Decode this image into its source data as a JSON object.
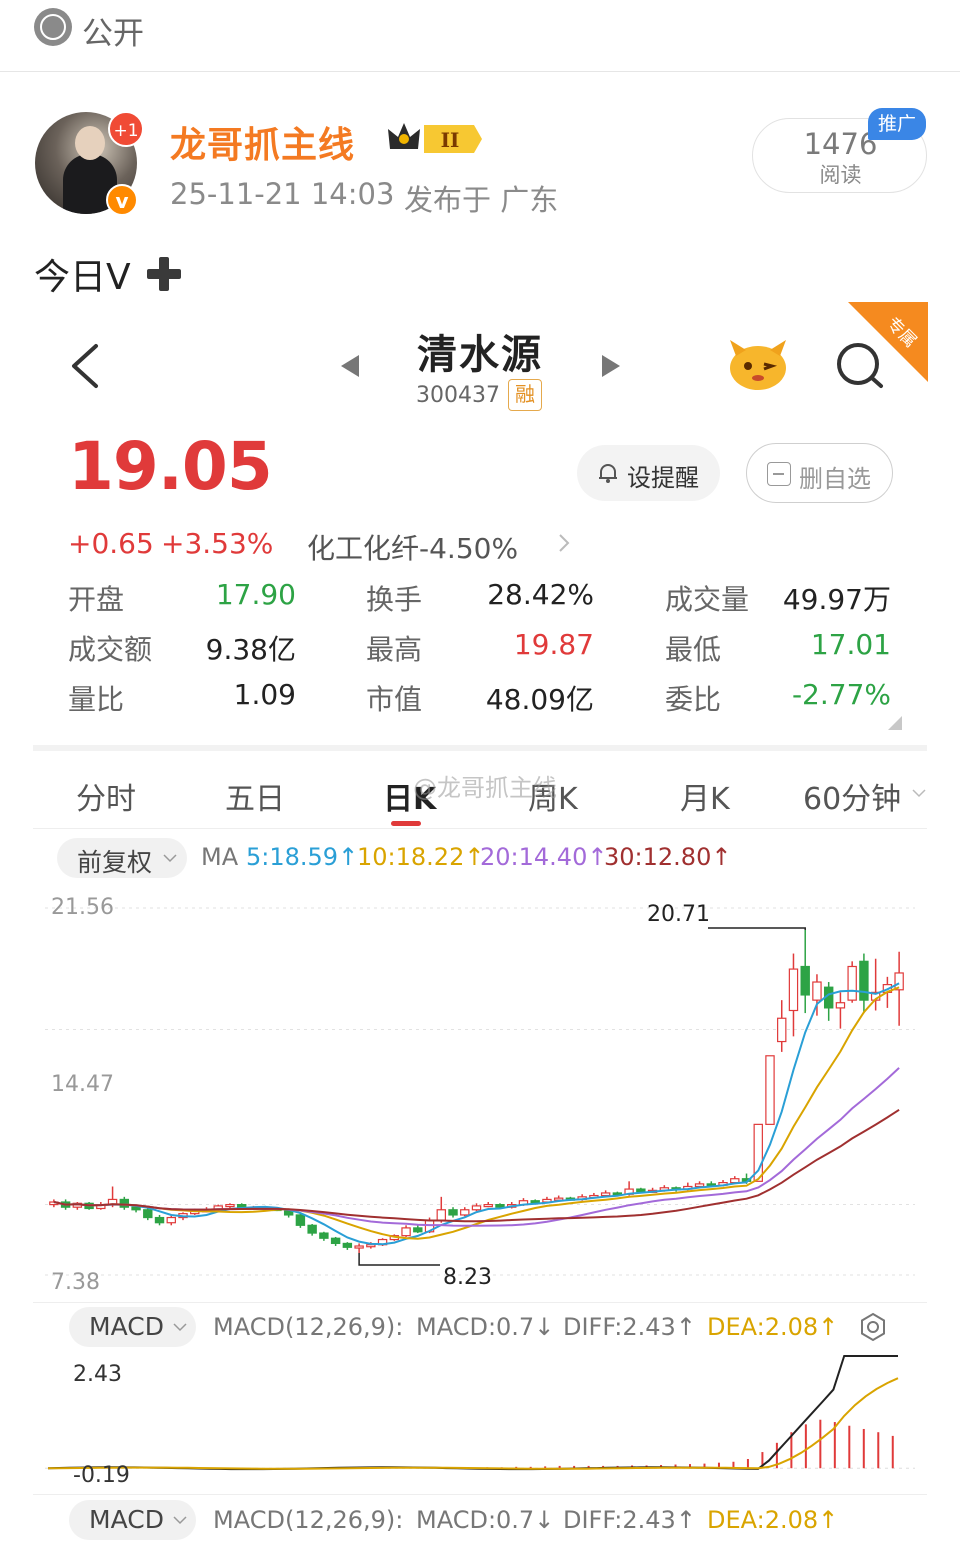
{
  "post": {
    "visibility": "公开",
    "author": {
      "name": "龙哥抓主线",
      "level": "II",
      "badge_plus": "+1"
    },
    "meta": {
      "time": "25-11-21 14:03",
      "location": "发布于 广东"
    },
    "reads": {
      "count": "1476",
      "label": "阅读",
      "promo": "推广"
    },
    "text": "今日V"
  },
  "stock": {
    "name": "清水源",
    "code": "300437",
    "margin_tag": "融",
    "exclusive_tag": "专属",
    "price": "19.05",
    "change": "+0.65",
    "change_pct": "+3.53%",
    "sector": "化工化纤-4.50%",
    "alert_label": "设提醒",
    "remove_label": "删自选",
    "quotes": [
      {
        "label": "开盘",
        "value": "17.90",
        "color": "#2da345"
      },
      {
        "label": "换手",
        "value": "28.42%",
        "color": "#222222"
      },
      {
        "label": "成交量",
        "value": "49.97万",
        "color": "#222222"
      },
      {
        "label": "成交额",
        "value": "9.38亿",
        "color": "#222222"
      },
      {
        "label": "最高",
        "value": "19.87",
        "color": "#e03a3a"
      },
      {
        "label": "最低",
        "value": "17.01",
        "color": "#2da345"
      },
      {
        "label": "量比",
        "value": "1.09",
        "color": "#222222"
      },
      {
        "label": "市值",
        "value": "48.09亿",
        "color": "#222222"
      },
      {
        "label": "委比",
        "value": "-2.77%",
        "color": "#2da345"
      }
    ]
  },
  "tabs": [
    "分时",
    "五日",
    "日K",
    "周K",
    "月K",
    "60分钟"
  ],
  "active_tab": "日K",
  "watermark": "@龙哥抓主线",
  "kline": {
    "adjust": "前复权",
    "ma_prefix": "MA",
    "ma5": "5:18.59↑",
    "ma10": "10:18.22↑",
    "ma20": "20:14.40↑",
    "ma30": "30:12.80↑",
    "axis_top": "21.56",
    "axis_mid": "14.47",
    "axis_bottom": "7.38",
    "high_mark": "20.71",
    "low_mark": "8.23"
  },
  "macd": {
    "selector": "MACD",
    "params": "MACD(12,26,9):",
    "macd": "MACD:0.7↓",
    "diff": "DIFF:2.43↑",
    "dea": "DEA:2.08↑",
    "axis_top": "2.43",
    "axis_bottom": "-0.19"
  },
  "colors": {
    "up": "#e03a3a",
    "down": "#2da345",
    "accent": "#f47a22",
    "ma5": "#2a9fd6",
    "ma10": "#d9a400",
    "ma20": "#a36ad9",
    "ma30": "#a03030"
  },
  "chart_data": {
    "type": "candlestick",
    "y_range": [
      7.38,
      21.56
    ],
    "annotations": [
      {
        "label": "20.71",
        "kind": "high"
      },
      {
        "label": "8.23",
        "kind": "low"
      }
    ],
    "candles": [
      {
        "o": 10.1,
        "c": 10.2,
        "h": 10.3,
        "l": 10.0
      },
      {
        "o": 10.2,
        "c": 10.0,
        "h": 10.3,
        "l": 9.9
      },
      {
        "o": 10.0,
        "c": 10.15,
        "h": 10.2,
        "l": 9.9
      },
      {
        "o": 10.15,
        "c": 9.95,
        "h": 10.2,
        "l": 9.9
      },
      {
        "o": 9.95,
        "c": 10.1,
        "h": 10.2,
        "l": 9.9
      },
      {
        "o": 10.1,
        "c": 10.3,
        "h": 10.8,
        "l": 10.0
      },
      {
        "o": 10.3,
        "c": 10.0,
        "h": 10.4,
        "l": 9.9
      },
      {
        "o": 10.0,
        "c": 9.9,
        "h": 10.1,
        "l": 9.8
      },
      {
        "o": 9.9,
        "c": 9.6,
        "h": 9.95,
        "l": 9.5
      },
      {
        "o": 9.6,
        "c": 9.4,
        "h": 9.7,
        "l": 9.3
      },
      {
        "o": 9.4,
        "c": 9.6,
        "h": 9.7,
        "l": 9.3
      },
      {
        "o": 9.6,
        "c": 9.75,
        "h": 9.8,
        "l": 9.5
      },
      {
        "o": 9.75,
        "c": 9.85,
        "h": 9.95,
        "l": 9.7
      },
      {
        "o": 9.85,
        "c": 9.9,
        "h": 10.0,
        "l": 9.8
      },
      {
        "o": 9.9,
        "c": 10.05,
        "h": 10.1,
        "l": 9.85
      },
      {
        "o": 10.05,
        "c": 10.1,
        "h": 10.15,
        "l": 9.95
      },
      {
        "o": 10.1,
        "c": 9.95,
        "h": 10.15,
        "l": 9.9
      },
      {
        "o": 9.95,
        "c": 10.0,
        "h": 10.05,
        "l": 9.9
      },
      {
        "o": 10.0,
        "c": 9.95,
        "h": 10.05,
        "l": 9.9
      },
      {
        "o": 9.95,
        "c": 9.9,
        "h": 10.0,
        "l": 9.85
      },
      {
        "o": 9.9,
        "c": 9.7,
        "h": 9.95,
        "l": 9.6
      },
      {
        "o": 9.7,
        "c": 9.3,
        "h": 9.75,
        "l": 9.2
      },
      {
        "o": 9.3,
        "c": 9.0,
        "h": 9.35,
        "l": 8.9
      },
      {
        "o": 9.0,
        "c": 8.8,
        "h": 9.05,
        "l": 8.7
      },
      {
        "o": 8.8,
        "c": 8.6,
        "h": 8.85,
        "l": 8.5
      },
      {
        "o": 8.6,
        "c": 8.45,
        "h": 8.65,
        "l": 8.35
      },
      {
        "o": 8.45,
        "c": 8.5,
        "h": 8.6,
        "l": 8.23
      },
      {
        "o": 8.5,
        "c": 8.55,
        "h": 8.65,
        "l": 8.4
      },
      {
        "o": 8.55,
        "c": 8.75,
        "h": 8.8,
        "l": 8.5
      },
      {
        "o": 8.75,
        "c": 8.9,
        "h": 8.95,
        "l": 8.7
      },
      {
        "o": 8.9,
        "c": 9.2,
        "h": 9.3,
        "l": 8.85
      },
      {
        "o": 9.2,
        "c": 9.05,
        "h": 9.3,
        "l": 9.0
      },
      {
        "o": 9.05,
        "c": 9.5,
        "h": 9.6,
        "l": 9.0
      },
      {
        "o": 9.5,
        "c": 9.9,
        "h": 10.4,
        "l": 9.4
      },
      {
        "o": 9.9,
        "c": 9.7,
        "h": 10.0,
        "l": 9.6
      },
      {
        "o": 9.7,
        "c": 9.9,
        "h": 10.0,
        "l": 9.65
      },
      {
        "o": 9.9,
        "c": 10.05,
        "h": 10.15,
        "l": 9.85
      },
      {
        "o": 10.05,
        "c": 10.1,
        "h": 10.2,
        "l": 10.0
      },
      {
        "o": 10.1,
        "c": 10.0,
        "h": 10.15,
        "l": 9.95
      },
      {
        "o": 10.0,
        "c": 10.1,
        "h": 10.2,
        "l": 9.95
      },
      {
        "o": 10.1,
        "c": 10.25,
        "h": 10.35,
        "l": 10.05
      },
      {
        "o": 10.25,
        "c": 10.2,
        "h": 10.3,
        "l": 10.1
      },
      {
        "o": 10.2,
        "c": 10.3,
        "h": 10.4,
        "l": 10.15
      },
      {
        "o": 10.3,
        "c": 10.35,
        "h": 10.45,
        "l": 10.25
      },
      {
        "o": 10.35,
        "c": 10.3,
        "h": 10.4,
        "l": 10.25
      },
      {
        "o": 10.3,
        "c": 10.4,
        "h": 10.5,
        "l": 10.25
      },
      {
        "o": 10.4,
        "c": 10.45,
        "h": 10.55,
        "l": 10.35
      },
      {
        "o": 10.45,
        "c": 10.55,
        "h": 10.65,
        "l": 10.4
      },
      {
        "o": 10.55,
        "c": 10.5,
        "h": 10.6,
        "l": 10.45
      },
      {
        "o": 10.5,
        "c": 10.7,
        "h": 11.0,
        "l": 10.45
      },
      {
        "o": 10.7,
        "c": 10.6,
        "h": 10.75,
        "l": 10.55
      },
      {
        "o": 10.6,
        "c": 10.65,
        "h": 10.75,
        "l": 10.55
      },
      {
        "o": 10.65,
        "c": 10.75,
        "h": 10.85,
        "l": 10.6
      },
      {
        "o": 10.75,
        "c": 10.7,
        "h": 10.8,
        "l": 10.6
      },
      {
        "o": 10.7,
        "c": 10.8,
        "h": 10.95,
        "l": 10.65
      },
      {
        "o": 10.8,
        "c": 10.9,
        "h": 11.0,
        "l": 10.75
      },
      {
        "o": 10.9,
        "c": 10.85,
        "h": 11.0,
        "l": 10.8
      },
      {
        "o": 10.85,
        "c": 10.95,
        "h": 11.05,
        "l": 10.8
      },
      {
        "o": 10.95,
        "c": 11.1,
        "h": 11.2,
        "l": 10.9
      },
      {
        "o": 11.1,
        "c": 11.0,
        "h": 11.3,
        "l": 10.9
      },
      {
        "o": 11.0,
        "c": 13.2,
        "h": 13.2,
        "l": 11.0
      },
      {
        "o": 13.2,
        "c": 15.85,
        "h": 15.85,
        "l": 13.2
      },
      {
        "o": 16.4,
        "c": 17.3,
        "h": 18.0,
        "l": 16.0
      },
      {
        "o": 17.6,
        "c": 19.2,
        "h": 19.8,
        "l": 16.6
      },
      {
        "o": 19.3,
        "c": 18.2,
        "h": 20.71,
        "l": 17.5
      },
      {
        "o": 18.0,
        "c": 18.7,
        "h": 19.0,
        "l": 17.4
      },
      {
        "o": 18.5,
        "c": 17.7,
        "h": 18.7,
        "l": 17.2
      },
      {
        "o": 17.7,
        "c": 17.9,
        "h": 18.3,
        "l": 16.9
      },
      {
        "o": 18.0,
        "c": 19.3,
        "h": 19.5,
        "l": 17.9
      },
      {
        "o": 19.5,
        "c": 18.0,
        "h": 19.8,
        "l": 17.5
      },
      {
        "o": 18.0,
        "c": 18.3,
        "h": 19.6,
        "l": 17.6
      },
      {
        "o": 18.3,
        "c": 18.6,
        "h": 18.9,
        "l": 17.7
      },
      {
        "o": 18.4,
        "c": 19.05,
        "h": 19.87,
        "l": 17.01
      }
    ],
    "ma_end": {
      "ma5": 18.59,
      "ma10": 18.22,
      "ma20": 14.4,
      "ma30": 12.8
    },
    "macd_range": [
      -0.19,
      2.43
    ],
    "macd_bars": [
      0.02,
      0.02,
      0.03,
      0.03,
      0.04,
      0.05,
      0.05,
      0.05,
      0.05,
      0.05,
      0.06,
      0.06,
      0.07,
      0.08,
      0.09,
      0.1,
      0.12,
      0.14,
      0.2,
      0.35,
      0.55,
      0.78,
      0.95,
      1.05,
      1.0,
      0.92,
      0.85,
      0.78,
      0.7
    ]
  }
}
